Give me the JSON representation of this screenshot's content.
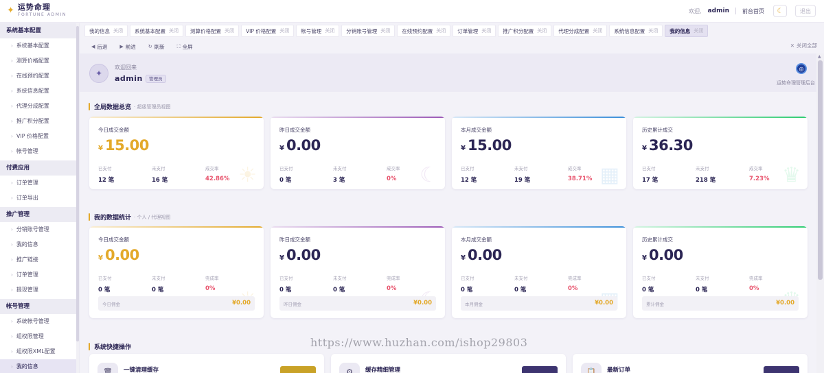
{
  "header": {
    "brand_name": "运势命理",
    "brand_sub": "FORTUNE ADMIN",
    "welcome": "欢迎,",
    "user": "admin",
    "front_link": "前台首页",
    "logout": "退出",
    "theme_icon": "moon-icon"
  },
  "sidebar": {
    "groups": [
      {
        "title": "系统基本配置",
        "items": [
          "系统基本配置",
          "测算价格配置",
          "在线预约配置",
          "系统信息配置",
          "代理分成配置",
          "推广积分配置",
          "VIP 价格配置",
          "帐号管理"
        ]
      },
      {
        "title": "付费应用",
        "items": [
          "订单管理",
          "订单导出"
        ]
      },
      {
        "title": "推广管理",
        "items": [
          "分销账号管理",
          "我的信息",
          "推广链接",
          "订单管理",
          "提现管理"
        ]
      },
      {
        "title": "帐号管理",
        "items": [
          "系统帐号管理",
          "组权限管理",
          "组权限XML配置",
          "我的信息"
        ]
      }
    ],
    "active_item": "我的信息"
  },
  "tabs": {
    "close_label": "关闭",
    "items": [
      "我的信息",
      "系统基本配置",
      "测算价格配置",
      "VIP 价格配置",
      "帐号管理",
      "分销账号管理",
      "在线预约配置",
      "订单管理",
      "推广积分配置",
      "代理分成配置",
      "系统信息配置",
      "我的信息"
    ],
    "active_index": 11
  },
  "toolbar": {
    "back": "后退",
    "forward": "前进",
    "refresh": "刷新",
    "fullscreen": "全屏",
    "close_all": "关闭全部"
  },
  "welcome_panel": {
    "greeting": "欢迎回来",
    "user": "admin",
    "role": "管理员",
    "backend_label": "运势命理管理后台"
  },
  "overview": {
    "title": "全局数据总览",
    "subtitle": "· 超级管理员视图",
    "cards": [
      {
        "label": "今日成交金额",
        "currency": "¥",
        "amount": "15.00",
        "paid_label": "已支付",
        "paid": "12 笔",
        "unpaid_label": "未支付",
        "unpaid": "16 笔",
        "rate_label": "成交率",
        "rate": "42.86%",
        "accent": "#e3a92a",
        "deco_icon": "sun-icon"
      },
      {
        "label": "昨日成交金额",
        "currency": "¥",
        "amount": "0.00",
        "paid_label": "已支付",
        "paid": "0 笔",
        "unpaid_label": "未支付",
        "unpaid": "3 笔",
        "rate_label": "成交率",
        "rate": "0%",
        "accent": "#9b59b6",
        "deco_icon": "moon-icon"
      },
      {
        "label": "本月成交金额",
        "currency": "¥",
        "amount": "15.00",
        "paid_label": "已支付",
        "paid": "12 笔",
        "unpaid_label": "未支付",
        "unpaid": "19 笔",
        "rate_label": "成交率",
        "rate": "38.71%",
        "accent": "#3b8fd9",
        "deco_icon": "calendar-icon"
      },
      {
        "label": "历史累计成交",
        "currency": "¥",
        "amount": "36.30",
        "paid_label": "已支付",
        "paid": "17 笔",
        "unpaid_label": "未支付",
        "unpaid": "218 笔",
        "rate_label": "成交率",
        "rate": "7.23%",
        "accent": "#2ecc71",
        "deco_icon": "trophy-icon"
      }
    ]
  },
  "my_stats": {
    "title": "我的数据统计",
    "subtitle": "· 个人 / 代理视图",
    "cards": [
      {
        "label": "今日成交金额",
        "currency": "¥",
        "amount": "0.00",
        "paid_label": "已支付",
        "paid": "0 笔",
        "unpaid_label": "未支付",
        "unpaid": "0 笔",
        "rate_label": "完成率",
        "rate": "0%",
        "commission_label": "今日佣金",
        "commission": "¥0.00",
        "accent": "#e3a92a",
        "deco_icon": "sun-icon"
      },
      {
        "label": "昨日成交金额",
        "currency": "¥",
        "amount": "0.00",
        "paid_label": "已支付",
        "paid": "0 笔",
        "unpaid_label": "未支付",
        "unpaid": "0 笔",
        "rate_label": "完成率",
        "rate": "0%",
        "commission_label": "昨日佣金",
        "commission": "¥0.00",
        "accent": "#9b59b6",
        "deco_icon": "moon-icon"
      },
      {
        "label": "本月成交金额",
        "currency": "¥",
        "amount": "0.00",
        "paid_label": "已支付",
        "paid": "0 笔",
        "unpaid_label": "未支付",
        "unpaid": "0 笔",
        "rate_label": "完成率",
        "rate": "0%",
        "commission_label": "本月佣金",
        "commission": "¥0.00",
        "accent": "#3b8fd9",
        "deco_icon": "calendar-icon"
      },
      {
        "label": "历史累计成交",
        "currency": "¥",
        "amount": "0.00",
        "paid_label": "已支付",
        "paid": "0 笔",
        "unpaid_label": "未支付",
        "unpaid": "0 笔",
        "rate_label": "完成率",
        "rate": "0%",
        "commission_label": "累计佣金",
        "commission": "¥0.00",
        "accent": "#2ecc71",
        "deco_icon": "trophy-icon"
      }
    ]
  },
  "quick_ops": {
    "title": "系统快捷操作",
    "items": [
      {
        "title": "一键清理缓存",
        "icon": "trash-icon",
        "button_color": "#c9a227"
      },
      {
        "title": "缓存精细管理",
        "icon": "gear-icon",
        "button_color": "#3d3470"
      },
      {
        "title": "最新订单",
        "icon": "clipboard-icon",
        "button_color": "#3d3470"
      }
    ]
  },
  "watermark": "https://www.huzhan.com/ishop29803"
}
